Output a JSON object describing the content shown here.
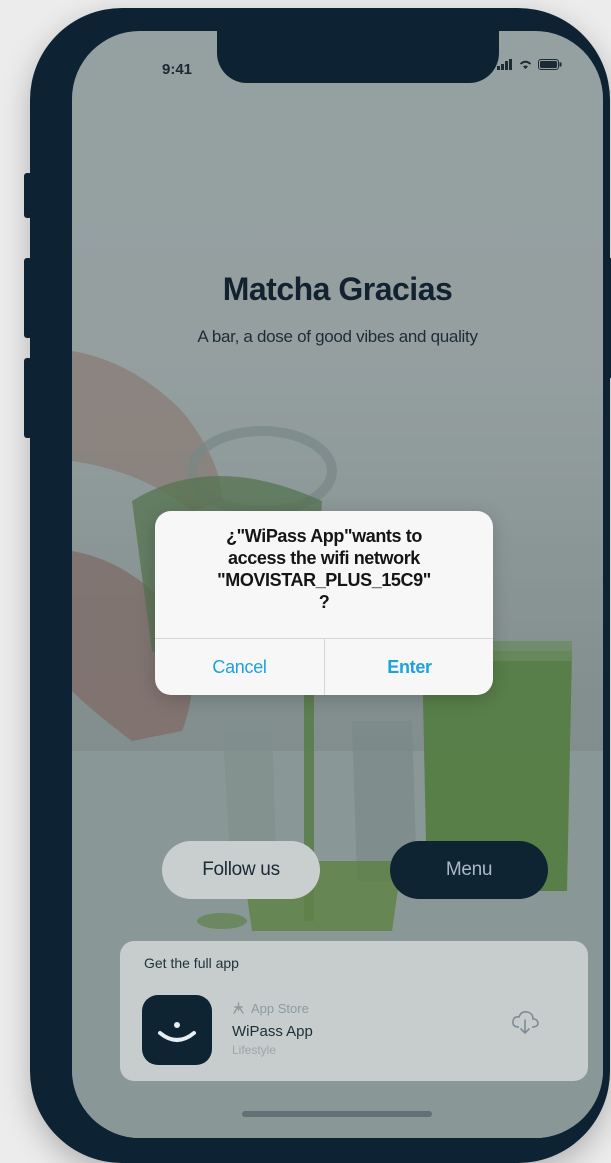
{
  "status_bar": {
    "time": "9:41",
    "icons": [
      "signal-icon",
      "wifi-icon",
      "battery-icon"
    ]
  },
  "venue": {
    "title": "Matcha Gracias",
    "tagline": "A bar, a dose of good vibes and quality"
  },
  "actions": {
    "follow_label": "Follow us",
    "menu_label": "Menu"
  },
  "app_banner": {
    "heading": "Get the full app",
    "store": "App Store",
    "app_name": "WiPass App",
    "category": "Lifestyle",
    "icons": [
      "app-store-icon",
      "cloud-download-icon"
    ]
  },
  "alert": {
    "message": "¿\"WiPass App\"wants to\naccess the wifi network\n\"MOVISTAR_PLUS_15C9\"\n?",
    "cancel_label": "Cancel",
    "enter_label": "Enter",
    "accent_color": "#1ea2dc"
  },
  "colors": {
    "device": "#0d2233",
    "menu_button": "#0f2433"
  }
}
